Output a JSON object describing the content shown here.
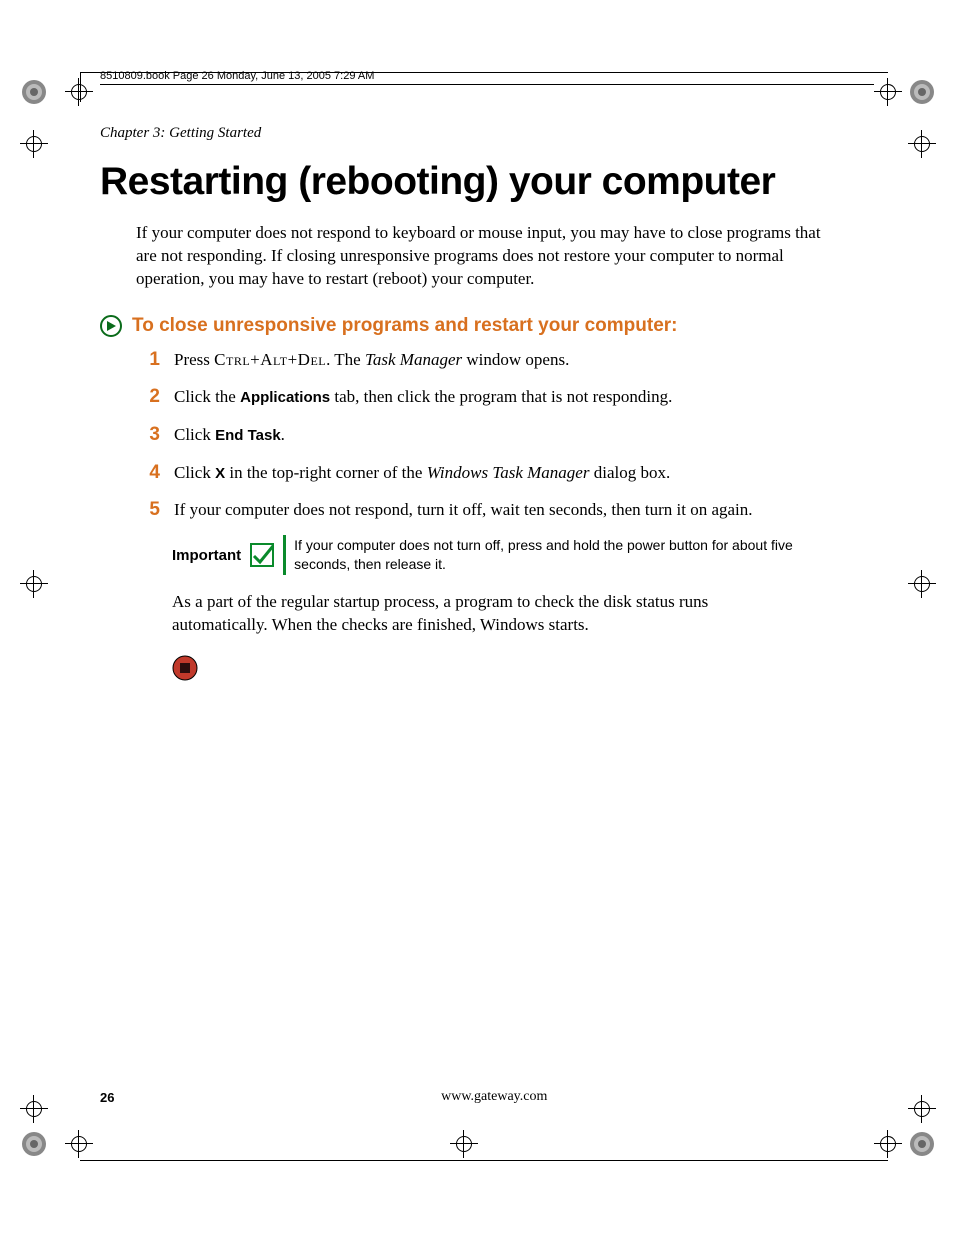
{
  "running_header": "8510809.book  Page 26  Monday, June 13, 2005  7:29 AM",
  "chapter_line": "Chapter 3: Getting Started",
  "title": "Restarting (rebooting) your computer",
  "intro": "If your computer does not respond to keyboard or mouse input, you may have to close programs that are not responding. If closing unresponsive programs does not restore your computer to normal operation, you may have to restart (reboot) your computer.",
  "proc_heading": "To close unresponsive programs and restart your computer:",
  "steps": [
    {
      "num": "1",
      "parts": [
        {
          "t": "plain",
          "v": "Press "
        },
        {
          "t": "smallcaps",
          "v": "Ctrl+Alt+Del"
        },
        {
          "t": "plain",
          "v": ". The "
        },
        {
          "t": "italic",
          "v": "Task Manager"
        },
        {
          "t": "plain",
          "v": " window opens."
        }
      ]
    },
    {
      "num": "2",
      "parts": [
        {
          "t": "plain",
          "v": "Click the "
        },
        {
          "t": "boldsans",
          "v": "Applications"
        },
        {
          "t": "plain",
          "v": " tab, then click the program that is not responding."
        }
      ]
    },
    {
      "num": "3",
      "parts": [
        {
          "t": "plain",
          "v": "Click "
        },
        {
          "t": "boldsans",
          "v": "End Task"
        },
        {
          "t": "plain",
          "v": "."
        }
      ]
    },
    {
      "num": "4",
      "parts": [
        {
          "t": "plain",
          "v": "Click "
        },
        {
          "t": "boldsans",
          "v": "X"
        },
        {
          "t": "plain",
          "v": " in the top-right corner of the "
        },
        {
          "t": "italic",
          "v": "Windows Task Manager"
        },
        {
          "t": "plain",
          "v": " dialog box."
        }
      ]
    },
    {
      "num": "5",
      "parts": [
        {
          "t": "plain",
          "v": "If your computer does not respond, turn it off, wait ten seconds, then turn it on again."
        }
      ]
    }
  ],
  "note_label": "Important",
  "note_text": "If your computer does not turn off, press and hold the power button for about five seconds, then release it.",
  "after_note": "As a part of the regular startup process, a program to check the disk status runs automatically. When the checks are finished, Windows starts.",
  "page_number": "26",
  "footer_url": "www.gateway.com"
}
